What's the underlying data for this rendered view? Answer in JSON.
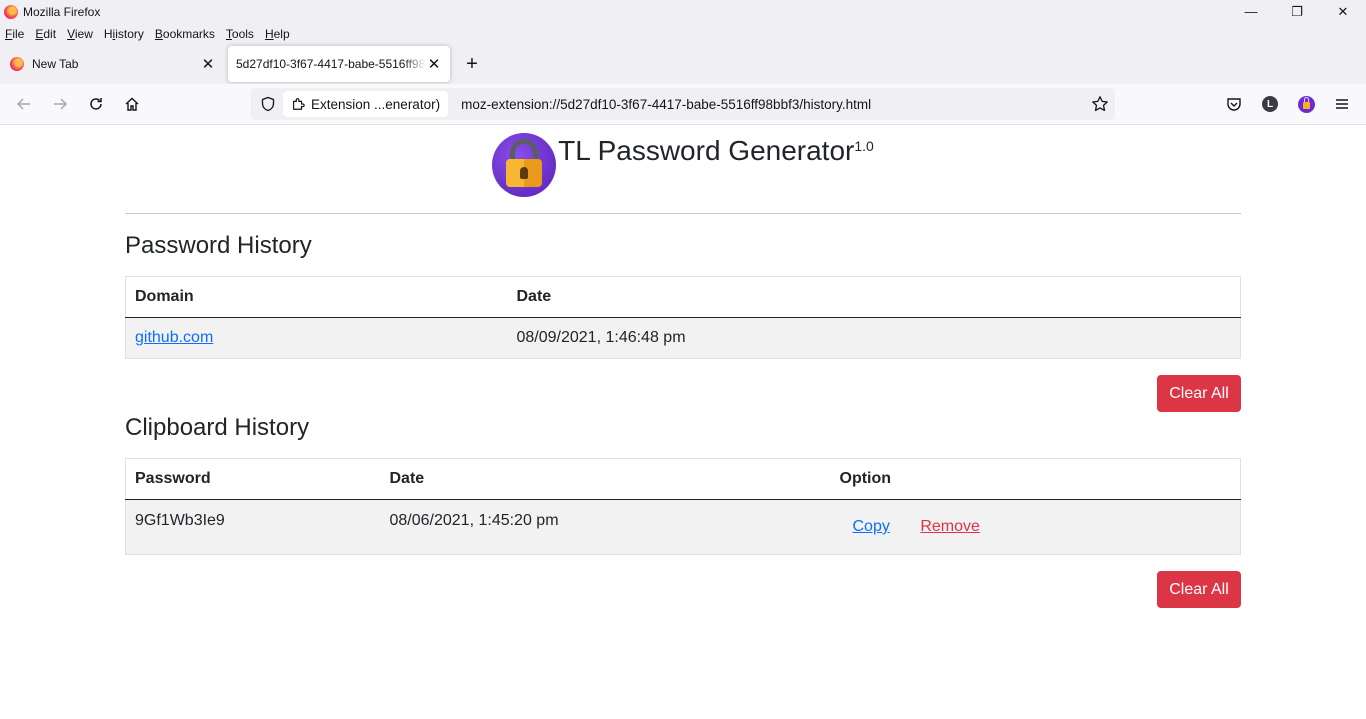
{
  "window": {
    "title": "Mozilla Firefox"
  },
  "menu": {
    "items": [
      {
        "first": "F",
        "rest": "ile"
      },
      {
        "first": "E",
        "rest": "dit"
      },
      {
        "first": "V",
        "rest": "iew"
      },
      {
        "first": "H",
        "rest": "istory"
      },
      {
        "first": "B",
        "rest": "ookmarks"
      },
      {
        "first": "T",
        "rest": "ools"
      },
      {
        "first": "H",
        "rest": "elp"
      }
    ]
  },
  "tabs": [
    {
      "label": "New Tab"
    },
    {
      "label": "5d27df10-3f67-4417-babe-5516ff98bbf3"
    }
  ],
  "urlbar": {
    "identity": "Extension ...enerator)",
    "url": "moz-extension://5d27df10-3f67-4417-babe-5516ff98bbf3/history.html"
  },
  "profile": {
    "initial": "L"
  },
  "app": {
    "title": "TL Password Generator",
    "version": "1.0"
  },
  "password_history": {
    "heading": "Password History",
    "columns": [
      "Domain",
      "Date"
    ],
    "rows": [
      {
        "domain": "github.com",
        "date": "08/09/2021, 1:46:48 pm"
      }
    ],
    "clear_label": "Clear All"
  },
  "clipboard_history": {
    "heading": "Clipboard History",
    "columns": [
      "Password",
      "Date",
      "Option"
    ],
    "rows": [
      {
        "password": "9Gf1Wb3Ie9",
        "date": "08/06/2021, 1:45:20 pm",
        "copy": "Copy",
        "remove": "Remove"
      }
    ],
    "clear_label": "Clear All"
  },
  "colors": {
    "danger": "#dc3545",
    "link": "#0d6efd",
    "accent": "#6c2bd9"
  }
}
